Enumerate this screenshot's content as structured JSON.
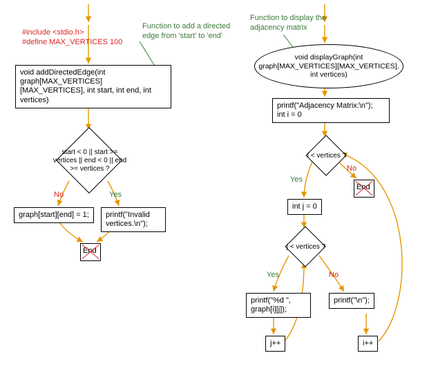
{
  "left": {
    "include": "#include <stdio.h>",
    "define": "#define MAX_VERTICES 100",
    "comment": "Function to add a directed edge from 'start' to 'end'",
    "func_sig": "void addDirectedEdge(int graph[MAX_VERTICES][MAX_VERTICES], int start, int end, int vertices)",
    "cond": "start < 0 || start >= vertices || end < 0 || end >= vertices ?",
    "yes": "Yes",
    "no": "No",
    "no_branch": "graph[start][end] = 1;",
    "yes_branch": "printf(\"Invalid vertices.\\n\");",
    "end": "End"
  },
  "right": {
    "comment": "Function to display the adjacency matrix",
    "func_sig": "void displayGraph(int graph[MAX_VERTICES][MAX_VERTICES], int vertices)",
    "init": "printf(\"Adjacency Matrix:\\n\");\nint i = 0",
    "cond_i": "i < vertices ?",
    "end1": "End",
    "init_j": "int j = 0",
    "cond_j": "j < vertices ?",
    "yes": "Yes",
    "no": "No",
    "print_cell": "printf(\"%d \", graph[i][j]);",
    "print_nl": "printf(\"\\n\");",
    "jpp": "j++",
    "ipp": "i++"
  },
  "chart_data": [
    {
      "type": "flowchart",
      "title": "addDirectedEdge",
      "nodes": [
        {
          "id": "L0",
          "kind": "start",
          "label": ""
        },
        {
          "id": "Lh",
          "kind": "annotation",
          "label": "#include <stdio.h>\n#define MAX_VERTICES 100"
        },
        {
          "id": "Lc",
          "kind": "comment",
          "label": "Function to add a directed edge from 'start' to 'end'"
        },
        {
          "id": "L1",
          "kind": "process",
          "label": "void addDirectedEdge(int graph[MAX_VERTICES][MAX_VERTICES], int start, int end, int vertices)"
        },
        {
          "id": "L2",
          "kind": "decision",
          "label": "start < 0 || start >= vertices || end < 0 || end >= vertices ?"
        },
        {
          "id": "L3n",
          "kind": "process",
          "label": "graph[start][end] = 1;"
        },
        {
          "id": "L3y",
          "kind": "process",
          "label": "printf(\"Invalid vertices.\\n\");"
        },
        {
          "id": "L4",
          "kind": "end",
          "label": "End"
        }
      ],
      "edges": [
        {
          "from": "L0",
          "to": "L1"
        },
        {
          "from": "L1",
          "to": "L2"
        },
        {
          "from": "L2",
          "to": "L3n",
          "label": "No"
        },
        {
          "from": "L2",
          "to": "L3y",
          "label": "Yes"
        },
        {
          "from": "L3n",
          "to": "L4"
        },
        {
          "from": "L3y",
          "to": "L4"
        }
      ]
    },
    {
      "type": "flowchart",
      "title": "displayGraph",
      "nodes": [
        {
          "id": "R0",
          "kind": "start",
          "label": ""
        },
        {
          "id": "Rc",
          "kind": "comment",
          "label": "Function to display the adjacency matrix"
        },
        {
          "id": "R1",
          "kind": "process_ellipse",
          "label": "void displayGraph(int graph[MAX_VERTICES][MAX_VERTICES], int vertices)"
        },
        {
          "id": "R2",
          "kind": "process",
          "label": "printf(\"Adjacency Matrix:\\n\");\nint i = 0"
        },
        {
          "id": "R3",
          "kind": "decision",
          "label": "i < vertices ?"
        },
        {
          "id": "R3e",
          "kind": "end",
          "label": "End"
        },
        {
          "id": "R4",
          "kind": "process",
          "label": "int j = 0"
        },
        {
          "id": "R5",
          "kind": "decision",
          "label": "j < vertices ?"
        },
        {
          "id": "R6y",
          "kind": "process",
          "label": "printf(\"%d \", graph[i][j]);"
        },
        {
          "id": "R6n",
          "kind": "process",
          "label": "printf(\"\\n\");"
        },
        {
          "id": "R7",
          "kind": "process",
          "label": "j++"
        },
        {
          "id": "R8",
          "kind": "process",
          "label": "i++"
        }
      ],
      "edges": [
        {
          "from": "R0",
          "to": "R1"
        },
        {
          "from": "R1",
          "to": "R2"
        },
        {
          "from": "R2",
          "to": "R3"
        },
        {
          "from": "R3",
          "to": "R4",
          "label": "Yes"
        },
        {
          "from": "R3",
          "to": "R3e",
          "label": "No"
        },
        {
          "from": "R4",
          "to": "R5"
        },
        {
          "from": "R5",
          "to": "R6y",
          "label": "Yes"
        },
        {
          "from": "R5",
          "to": "R6n",
          "label": "No"
        },
        {
          "from": "R6y",
          "to": "R7"
        },
        {
          "from": "R7",
          "to": "R5"
        },
        {
          "from": "R6n",
          "to": "R8"
        },
        {
          "from": "R8",
          "to": "R3"
        }
      ]
    }
  ]
}
